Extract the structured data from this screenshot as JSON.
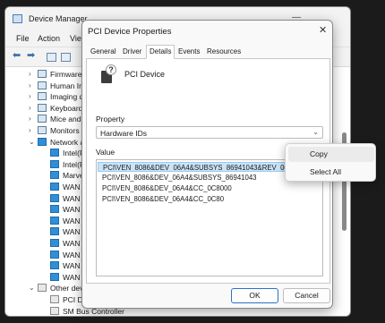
{
  "device_manager": {
    "title": "Device Manager",
    "menu": [
      "File",
      "Action",
      "View"
    ],
    "tree": [
      {
        "label": "Firmware",
        "icon": "firmware-icon",
        "expanded": false
      },
      {
        "label": "Human Interface Devices",
        "icon": "hid-icon",
        "expanded": false
      },
      {
        "label": "Imaging devices",
        "icon": "camera-icon",
        "expanded": false
      },
      {
        "label": "Keyboards",
        "icon": "keyboard-icon",
        "expanded": false
      },
      {
        "label": "Mice and other pointing devices",
        "icon": "mouse-icon",
        "expanded": false
      },
      {
        "label": "Monitors",
        "icon": "monitor-icon",
        "expanded": false
      },
      {
        "label": "Network adapters",
        "icon": "network-icon",
        "expanded": true
      },
      {
        "label": "Intel(R)",
        "icon": "network-adapter-icon",
        "child": true
      },
      {
        "label": "Intel(R)",
        "icon": "network-adapter-icon",
        "child": true
      },
      {
        "label": "Marvell",
        "icon": "network-adapter-icon",
        "child": true
      },
      {
        "label": "WAN",
        "icon": "network-adapter-icon",
        "child": true
      },
      {
        "label": "WAN",
        "icon": "network-adapter-icon",
        "child": true
      },
      {
        "label": "WAN",
        "icon": "network-adapter-icon",
        "child": true
      },
      {
        "label": "WAN",
        "icon": "network-adapter-icon",
        "child": true
      },
      {
        "label": "WAN",
        "icon": "network-adapter-icon",
        "child": true
      },
      {
        "label": "WAN",
        "icon": "network-adapter-icon",
        "child": true
      },
      {
        "label": "WAN",
        "icon": "network-adapter-icon",
        "child": true
      },
      {
        "label": "WAN",
        "icon": "network-adapter-icon",
        "child": true
      },
      {
        "label": "WAN",
        "icon": "network-adapter-icon",
        "child": true
      },
      {
        "label": "Other devices",
        "icon": "warning-device-icon",
        "expanded": true
      },
      {
        "label": "PCI Device",
        "icon": "unknown-device-icon",
        "child": true
      },
      {
        "label": "SM Bus Controller",
        "icon": "unknown-device-icon",
        "child": true
      }
    ]
  },
  "dialog": {
    "title": "PCI Device Properties",
    "close": "✕",
    "tabs": [
      "General",
      "Driver",
      "Details",
      "Events",
      "Resources"
    ],
    "active_tab": "Details",
    "device_name": "PCI Device",
    "property_label": "Property",
    "property_value": "Hardware IDs",
    "value_label": "Value",
    "values": [
      "PCI\\VEN_8086&DEV_06A4&SUBSYS_86941043&REV_00",
      "PCI\\VEN_8086&DEV_06A4&SUBSYS_86941043",
      "PCI\\VEN_8086&DEV_06A4&CC_0C8000",
      "PCI\\VEN_8086&DEV_06A4&CC_0C80"
    ],
    "ok_label": "OK",
    "cancel_label": "Cancel"
  },
  "context_menu": {
    "items": [
      "Copy",
      "Select All"
    ]
  }
}
